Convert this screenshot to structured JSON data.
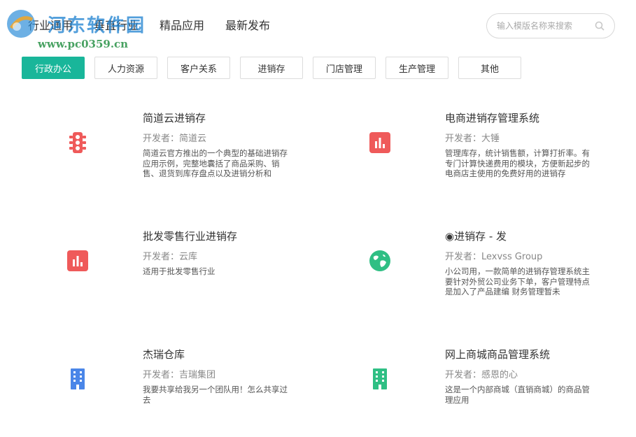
{
  "watermark": {
    "title": "河东软件园",
    "url": "www.pc0359.cn"
  },
  "nav": {
    "items": [
      "行业通用",
      "垂直行业",
      "精品应用",
      "最新发布"
    ]
  },
  "search": {
    "placeholder": "输入模版名称来搜索"
  },
  "categories": [
    "行政办公",
    "人力资源",
    "客户关系",
    "进销存",
    "门店管理",
    "生产管理",
    "其他"
  ],
  "active_category": "行政办公",
  "cards": [
    {
      "title": "简道云进销存",
      "developer": "开发者：简道云",
      "description": "简道云官方推出的一个典型的基础进销存应用示例，完整地囊括了商品采购、销售、退货到库存盘点以及进销分析和",
      "icon": "traffic-light-icon",
      "icon_color": "#ef5a5a"
    },
    {
      "title": "电商进销存管理系统",
      "developer": "开发者：大锤",
      "description": "管理库存，统计销售额，计算打折率。有专门计算快递费用的模块，方便新起步的电商店主使用的免费好用的进销存",
      "icon": "bar-chart-icon",
      "icon_color": "#ef5a5a"
    },
    {
      "title": "批发零售行业进销存",
      "developer": "开发者：云库",
      "description": "适用于批发零售行业",
      "icon": "bar-chart-icon",
      "icon_color": "#ef5a5a"
    },
    {
      "title": "◉进销存 - 发",
      "developer": "开发者：Lexvss Group",
      "description": "小公司用，一款简单的进销存管理系统主要针对外贸公司业务下单，客户管理特点是加入了产品建编 财务管理暂未",
      "icon": "globe-icon",
      "icon_color": "#2fbf84"
    },
    {
      "title": "杰瑞仓库",
      "developer": "开发者：吉瑞集团",
      "description": "我要共享给我另一个团队用！怎么共享过去",
      "icon": "building-icon",
      "icon_color": "#4a86e8"
    },
    {
      "title": "网上商城商品管理系统",
      "developer": "开发者：感恩的心",
      "description": "这是一个内部商城（直销商城）的商品管理应用",
      "icon": "building-icon",
      "icon_color": "#2fbf84"
    }
  ]
}
